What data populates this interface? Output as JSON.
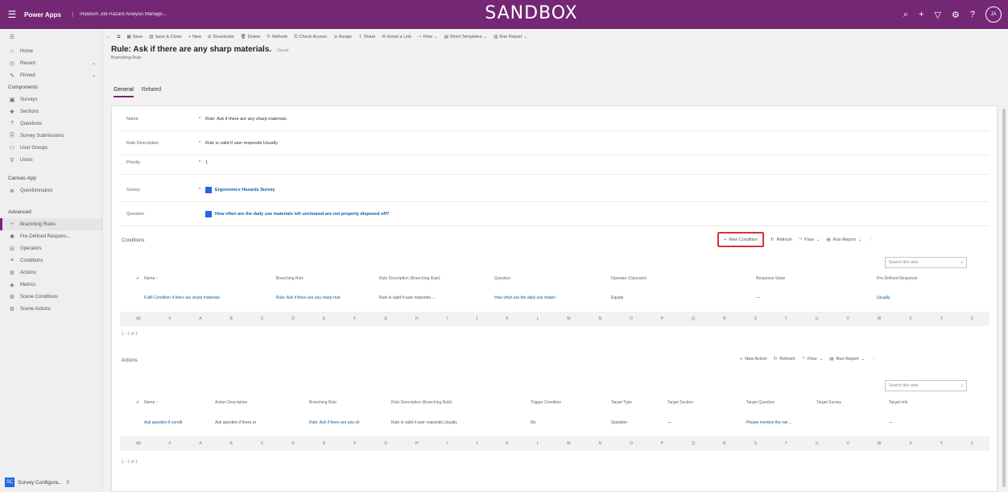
{
  "topbar": {
    "app": "Power Apps",
    "app_name": "Impetum Job Hazard Analysis Manage...",
    "environment": "SANDBOX",
    "user_initials": "JA"
  },
  "sidebar": {
    "items_top": [
      {
        "label": "Home",
        "icon": "home-icon"
      },
      {
        "label": "Recent",
        "icon": "clock-icon",
        "chevron": true
      },
      {
        "label": "Pinned",
        "icon": "pin-icon",
        "chevron": true
      }
    ],
    "group1": "Components",
    "items_components": [
      {
        "label": "Surveys",
        "icon": "doc-icon"
      },
      {
        "label": "Sections",
        "icon": "section-icon"
      },
      {
        "label": "Questions",
        "icon": "question-icon"
      },
      {
        "label": "Survey Submissions",
        "icon": "submission-icon"
      },
      {
        "label": "User Groups",
        "icon": "group-icon"
      },
      {
        "label": "Users",
        "icon": "user-icon"
      }
    ],
    "group2": "Canvas App",
    "items_canvas": [
      {
        "label": "Questionnaires",
        "icon": "list-icon"
      }
    ],
    "group3": "Advanced",
    "items_advanced": [
      {
        "label": "Branching Rules",
        "icon": "branch-icon",
        "active": true
      },
      {
        "label": "Pre-Defined Respons...",
        "icon": "predef-icon"
      },
      {
        "label": "Operators",
        "icon": "operator-icon"
      },
      {
        "label": "Conditions",
        "icon": "condition-icon"
      },
      {
        "label": "Actions",
        "icon": "action-icon"
      },
      {
        "label": "Metrics",
        "icon": "metric-icon"
      },
      {
        "label": "Scene Conditions",
        "icon": "scene-cond-icon"
      },
      {
        "label": "Scene Actions",
        "icon": "scene-act-icon"
      }
    ],
    "area_badge": "SC",
    "area_label": "Survey Configura..."
  },
  "commands": [
    {
      "label": "←",
      "icon": "back-icon"
    },
    {
      "label": "⧉",
      "icon": "popout-icon"
    },
    {
      "label": "Save",
      "icon": "save-icon"
    },
    {
      "label": "Save & Close",
      "icon": "save-close-icon"
    },
    {
      "label": "New",
      "icon": "add-icon"
    },
    {
      "label": "Deactivate",
      "icon": "deactivate-icon"
    },
    {
      "label": "Delete",
      "icon": "delete-icon"
    },
    {
      "label": "Refresh",
      "icon": "refresh-icon"
    },
    {
      "label": "Check Access",
      "icon": "check-access-icon"
    },
    {
      "label": "Assign",
      "icon": "assign-icon"
    },
    {
      "label": "Share",
      "icon": "share-icon"
    },
    {
      "label": "Email a Link",
      "icon": "email-icon"
    },
    {
      "label": "Flow",
      "icon": "flow-icon",
      "chevron": true
    },
    {
      "label": "Word Templates",
      "icon": "word-icon",
      "chevron": true
    },
    {
      "label": "Run Report",
      "icon": "report-icon",
      "chevron": true
    }
  ],
  "record": {
    "title": "Rule: Ask if there are any sharp materials.",
    "saved_status": "- Saved",
    "entity": "Branching Rule"
  },
  "tabs": [
    "General",
    "Related"
  ],
  "fields": [
    {
      "label": "Name",
      "required": true,
      "value": "Rule: Ask if there are any sharp materials."
    },
    {
      "label": "Rule Description",
      "required": true,
      "value": "Rule is valid if user responds Usually"
    },
    {
      "label": "Priority",
      "required": true,
      "value": "1"
    },
    {
      "label": "Survey",
      "required": true,
      "value": "Ergonomics Hazards Survey",
      "lookup": true
    },
    {
      "label": "Question",
      "required": false,
      "value": "How often are the daily use materials left uncleaned are not properly disposed off?",
      "lookup": true
    }
  ],
  "conditions": {
    "title": "Conditions",
    "toolbar": {
      "new": "New Condition",
      "refresh": "Refresh",
      "flow": "Flow",
      "report": "Run Report"
    },
    "search_placeholder": "Search this view",
    "columns": [
      "Name ↑",
      "Branching Rule",
      "Rule Description (Branching Rule)",
      "Question",
      "Operator (Operator)",
      "Response Value",
      "Pre-Defined Response"
    ],
    "row": [
      "Fulfil Condition if there are sharp materials.",
      "Rule: Ask if there are any sharp mat",
      "Rule is valid if user responds ...",
      "How often are the daily use materi",
      "Equals",
      "—",
      "Usually"
    ],
    "pager": "1 - 1 of 1"
  },
  "actions": {
    "title": "Actions",
    "toolbar": {
      "new": "New Action",
      "refresh": "Refresh",
      "flow": "Flow",
      "report": "Run Report"
    },
    "search_placeholder": "Search this view",
    "columns": [
      "Name ↑",
      "Action Description",
      "Branching Rule",
      "Rule Description (Branching Rule)",
      "Trigger Condition",
      "Target Type",
      "Target Section",
      "Target Question",
      "Target Survey",
      "Target Info"
    ],
    "row": [
      "Ask question if condit",
      "Ask question if there ar",
      "Rule: Ask if there are any sh",
      "Rule is valid if user responds Usually",
      "No",
      "Question",
      "—",
      "Please mention the nat ...",
      "",
      "—"
    ],
    "pager": "1 - 1 of 1"
  },
  "alphabet": [
    "All",
    "#",
    "A",
    "B",
    "C",
    "D",
    "E",
    "F",
    "G",
    "H",
    "I",
    "J",
    "K",
    "L",
    "M",
    "N",
    "O",
    "P",
    "Q",
    "R",
    "S",
    "T",
    "U",
    "V",
    "W",
    "X",
    "Y",
    "Z"
  ]
}
